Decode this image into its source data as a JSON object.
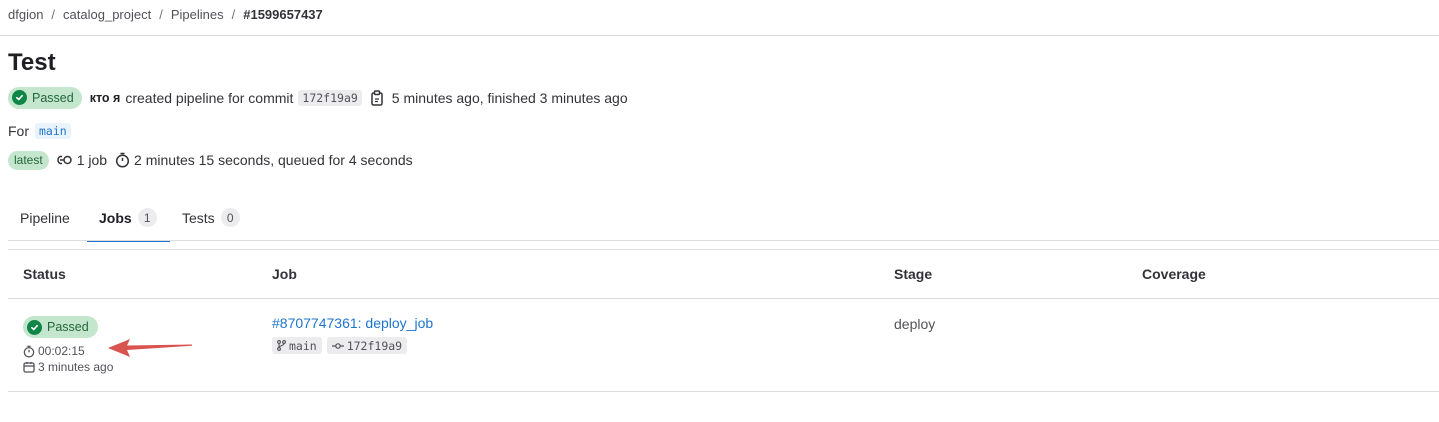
{
  "breadcrumb": {
    "items": [
      "dfgion",
      "catalog_project",
      "Pipelines"
    ],
    "current": "#1599657437",
    "separator": "/"
  },
  "pipeline": {
    "title": "Test",
    "status": "Passed",
    "user": "кто я",
    "created_text": "created pipeline for commit",
    "commit_sha": "172f19a9",
    "time_text": "5 minutes ago, finished 3 minutes ago",
    "for_label": "For",
    "ref": "main",
    "latest_badge": "latest",
    "jobs_count_text": "1 job",
    "duration_text": "2 minutes 15 seconds, queued for 4 seconds"
  },
  "tabs": [
    {
      "label": "Pipeline",
      "count": null
    },
    {
      "label": "Jobs",
      "count": "1"
    },
    {
      "label": "Tests",
      "count": "0"
    }
  ],
  "jobs_table": {
    "headers": {
      "status": "Status",
      "job": "Job",
      "stage": "Stage",
      "coverage": "Coverage"
    },
    "rows": [
      {
        "status": "Passed",
        "duration": "00:02:15",
        "finished": "3 minutes ago",
        "job_name": "#8707747361: deploy_job",
        "ref": "main",
        "commit": "172f19a9",
        "stage": "deploy",
        "coverage": ""
      }
    ]
  },
  "colors": {
    "accent": "#1f75cb",
    "success_bg": "#c3e6cd",
    "success_icon": "#108548",
    "annotation_arrow": "#d9534f"
  },
  "icons": {
    "status": "check-circle-icon",
    "copy": "clipboard-icon",
    "jobs": "pipeline-jobs-icon",
    "duration": "timer-icon",
    "finished": "calendar-icon",
    "branch": "branch-icon",
    "commit": "commit-icon"
  }
}
